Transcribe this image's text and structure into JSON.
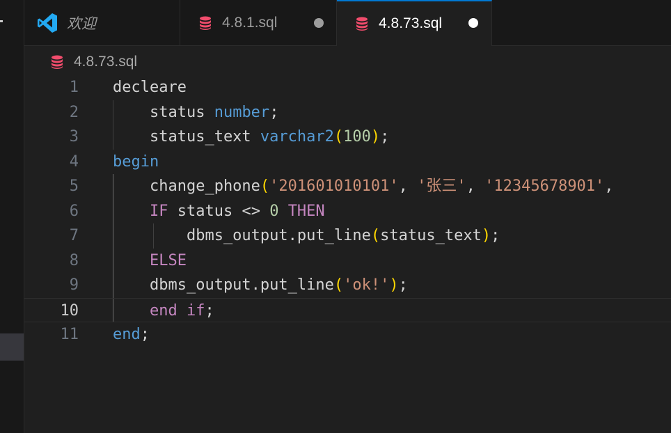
{
  "tabs": [
    {
      "label": "欢迎",
      "icon": "vscode-logo-icon",
      "dirty": false,
      "active": false
    },
    {
      "label": "4.8.1.sql",
      "icon": "database-icon",
      "dirty": true,
      "active": false
    },
    {
      "label": "4.8.73.sql",
      "icon": "database-icon",
      "dirty": true,
      "active": true
    }
  ],
  "breadcrumb": {
    "file": "4.8.73.sql",
    "icon": "database-icon"
  },
  "editor": {
    "current_line": 10,
    "line_numbers": [
      "1",
      "2",
      "3",
      "4",
      "5",
      "6",
      "7",
      "8",
      "9",
      "10",
      "11"
    ],
    "lines": [
      [
        {
          "t": "decleare",
          "c": "plain"
        }
      ],
      [
        {
          "t": "    status ",
          "c": "plain"
        },
        {
          "t": "number",
          "c": "kw-blue"
        },
        {
          "t": ";",
          "c": "plain"
        }
      ],
      [
        {
          "t": "    status_text ",
          "c": "plain"
        },
        {
          "t": "varchar2",
          "c": "kw-blue"
        },
        {
          "t": "(",
          "c": "paren"
        },
        {
          "t": "100",
          "c": "num"
        },
        {
          "t": ")",
          "c": "paren"
        },
        {
          "t": ";",
          "c": "plain"
        }
      ],
      [
        {
          "t": "begin",
          "c": "kw-blue"
        }
      ],
      [
        {
          "t": "    change_phone",
          "c": "plain"
        },
        {
          "t": "(",
          "c": "paren"
        },
        {
          "t": "'201601010101'",
          "c": "str"
        },
        {
          "t": ", ",
          "c": "plain"
        },
        {
          "t": "'张三'",
          "c": "str"
        },
        {
          "t": ", ",
          "c": "plain"
        },
        {
          "t": "'12345678901'",
          "c": "str"
        },
        {
          "t": ",",
          "c": "plain"
        }
      ],
      [
        {
          "t": "    ",
          "c": "plain"
        },
        {
          "t": "IF",
          "c": "kw-purple"
        },
        {
          "t": " status <> ",
          "c": "plain"
        },
        {
          "t": "0",
          "c": "num"
        },
        {
          "t": " ",
          "c": "plain"
        },
        {
          "t": "THEN",
          "c": "kw-purple"
        }
      ],
      [
        {
          "t": "        dbms_output.put_line",
          "c": "plain"
        },
        {
          "t": "(",
          "c": "paren"
        },
        {
          "t": "status_text",
          "c": "plain"
        },
        {
          "t": ")",
          "c": "paren"
        },
        {
          "t": ";",
          "c": "plain"
        }
      ],
      [
        {
          "t": "    ",
          "c": "plain"
        },
        {
          "t": "ELSE",
          "c": "kw-purple"
        }
      ],
      [
        {
          "t": "    dbms_output.put_line",
          "c": "plain"
        },
        {
          "t": "(",
          "c": "paren"
        },
        {
          "t": "'ok!'",
          "c": "str"
        },
        {
          "t": ")",
          "c": "paren"
        },
        {
          "t": ";",
          "c": "plain"
        }
      ],
      [
        {
          "t": "    ",
          "c": "plain"
        },
        {
          "t": "end",
          "c": "kw-purple"
        },
        {
          "t": " ",
          "c": "plain"
        },
        {
          "t": "if",
          "c": "kw-purple"
        },
        {
          "t": ";",
          "c": "plain"
        }
      ],
      [
        {
          "t": "end",
          "c": "kw-blue"
        },
        {
          "t": ";",
          "c": "plain"
        }
      ]
    ]
  },
  "colors": {
    "keyword_blue": "#569cd6",
    "keyword_purple": "#c586c0",
    "string": "#ce9178",
    "number": "#b5cea8",
    "bracket": "#ffd700",
    "db_icon": "#f14c6c",
    "vscode_logo": "#23a9f2",
    "active_tab_accent": "#0078d4"
  }
}
